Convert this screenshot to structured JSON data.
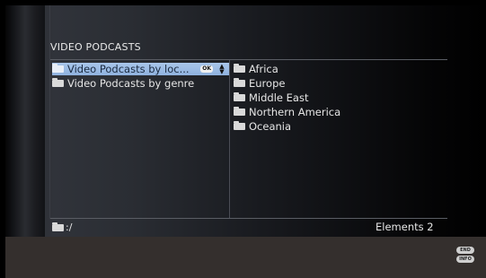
{
  "panel": {
    "title": "VIDEO PODCASTS"
  },
  "left_list": {
    "items": [
      {
        "label": "Video Podcasts by loc...",
        "selected": true,
        "icon": "folder-icon"
      },
      {
        "label": "Video Podcasts by genre",
        "selected": false,
        "icon": "folder-icon"
      }
    ],
    "ok_badge": "OK",
    "arrows_icon": "up-down-arrows-icon"
  },
  "right_list": {
    "items": [
      {
        "label": "Africa",
        "icon": "folder-icon"
      },
      {
        "label": "Europe",
        "icon": "folder-icon"
      },
      {
        "label": "Middle East",
        "icon": "folder-icon"
      },
      {
        "label": "Northern America",
        "icon": "folder-icon"
      },
      {
        "label": "Oceania",
        "icon": "folder-icon"
      }
    ]
  },
  "footer": {
    "path": ":/",
    "elements": "Elements 2"
  },
  "buttons": {
    "end": "END",
    "info": "INFO"
  },
  "colors": {
    "selection": "#8fb2df",
    "bottom_bar": "#342f2d",
    "text": "#e6e6e6"
  }
}
